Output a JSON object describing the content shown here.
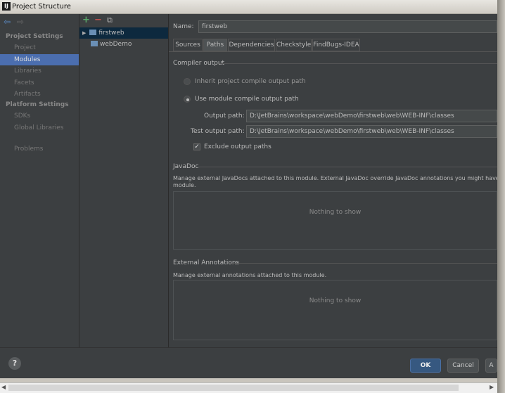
{
  "window": {
    "title": "Project Structure",
    "icon_text": "IJ"
  },
  "nav": {
    "tool_back": "◆",
    "tool_forward": "⇨",
    "project_settings_header": "Project Settings",
    "items_project": [
      "Project",
      "Modules",
      "Libraries",
      "Facets",
      "Artifacts"
    ],
    "platform_settings_header": "Platform Settings",
    "items_platform": [
      "SDKs",
      "Global Libraries"
    ],
    "problems": "Problems",
    "selected": "Modules"
  },
  "tree": {
    "toolbar": {
      "add": "+",
      "remove": "−",
      "copy": "⧉"
    },
    "modules": [
      {
        "label": "firstweb",
        "expanded_arrow": "▶",
        "selected": true
      },
      {
        "label": "webDemo",
        "selected": false
      }
    ]
  },
  "module": {
    "name_label": "Name:",
    "name_value": "firstweb",
    "tabs": [
      "Sources",
      "Paths",
      "Dependencies",
      "Checkstyle",
      "FindBugs-IDEA"
    ],
    "active_tab": "Paths",
    "compiler_output": {
      "title": "Compiler output",
      "inherit_label": "Inherit project compile output path",
      "use_module_label": "Use module compile output path",
      "selected": "use_module",
      "output_path_label": "Output path:",
      "output_path_value": "D:\\JetBrains\\workspace\\webDemo\\firstweb\\web\\WEB-INF\\classes",
      "test_output_path_label": "Test output path:",
      "test_output_path_value": "D:\\JetBrains\\workspace\\webDemo\\firstweb\\web\\WEB-INF\\classes",
      "exclude_label": "Exclude output paths",
      "exclude_checked": true
    },
    "javadoc": {
      "title": "JavaDoc",
      "description": "Manage external JavaDocs attached to this module. External JavaDoc override JavaDoc annotations you might have in your",
      "description_line2": "module.",
      "empty_text": "Nothing to show"
    },
    "external_annotations": {
      "title": "External Annotations",
      "description": "Manage external annotations attached to this module.",
      "empty_text": "Nothing to show"
    }
  },
  "footer": {
    "help": "?",
    "ok": "OK",
    "cancel": "Cancel",
    "apply_partial": "A"
  },
  "scrollbar": {
    "left": "◀",
    "right": "▶"
  }
}
